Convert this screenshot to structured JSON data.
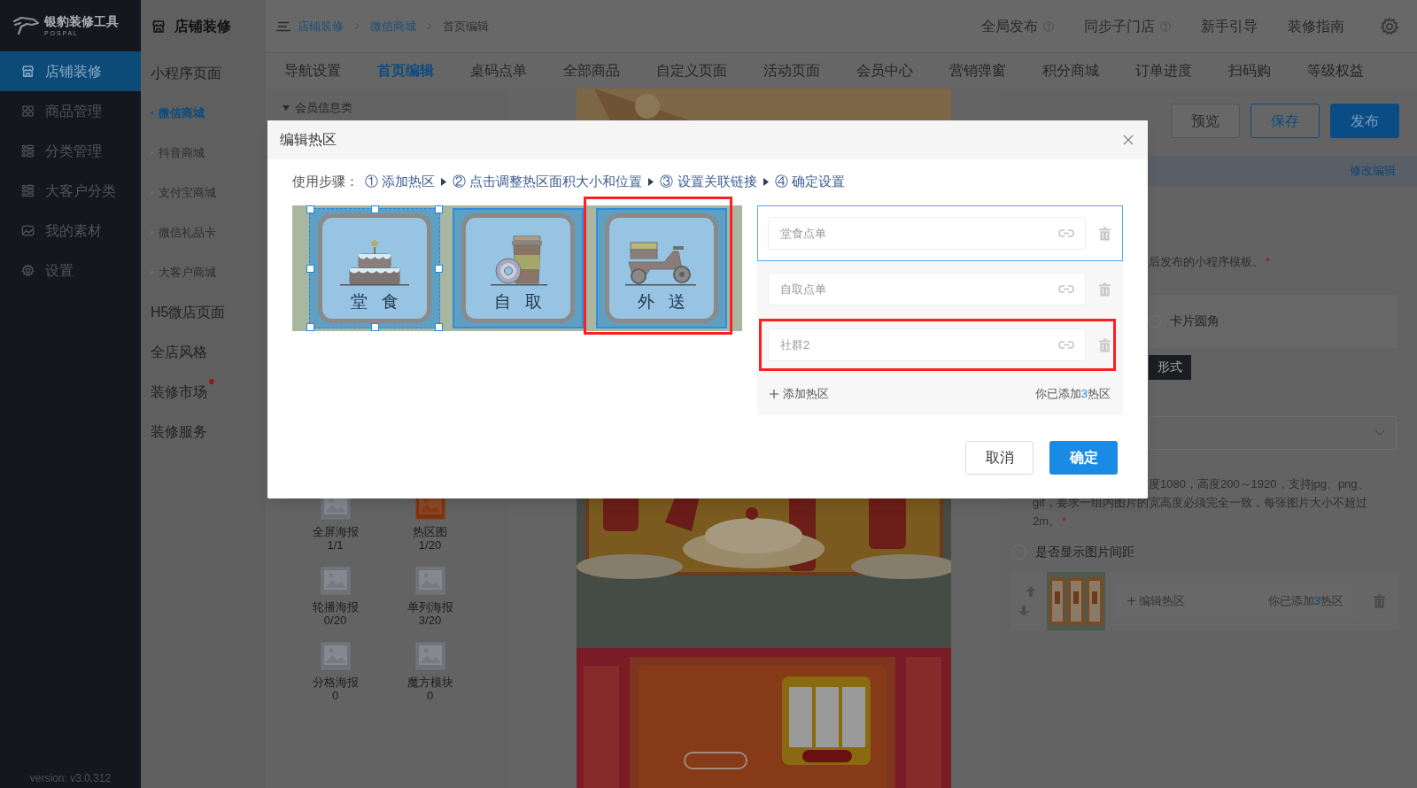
{
  "sidebar": {
    "logo": {
      "name": "银豹装修工具",
      "subtext": "P O S P A L"
    },
    "items": [
      {
        "label": "店铺装修",
        "selected": true
      },
      {
        "label": "商品管理",
        "selected": false
      },
      {
        "label": "分类管理",
        "selected": false
      },
      {
        "label": "大客户分类",
        "selected": false
      },
      {
        "label": "我的素材",
        "selected": false
      },
      {
        "label": "设置",
        "selected": false
      }
    ],
    "version": "version: v3.0.312"
  },
  "subnav": {
    "title": "店铺装修",
    "items": [
      {
        "label": "小程序页面",
        "dot": false,
        "children": [
          {
            "label": "微信商城",
            "selected": true
          },
          {
            "label": "抖音商城",
            "selected": false
          },
          {
            "label": "支付宝商城",
            "selected": false
          },
          {
            "label": "微信礼品卡",
            "selected": false
          },
          {
            "label": "大客户商城",
            "selected": false
          }
        ]
      },
      {
        "label": "H5微店页面",
        "dot": false
      },
      {
        "label": "全店风格",
        "dot": false
      },
      {
        "label": "装修市场",
        "dot": true
      },
      {
        "label": "装修服务",
        "dot": false
      }
    ]
  },
  "header": {
    "breadcrumb": [
      {
        "label": "店铺装修",
        "link": true
      },
      {
        "label": "微信商城",
        "link": true
      },
      {
        "label": "首页编辑",
        "link": false
      }
    ],
    "actions": [
      {
        "label": "全局发布",
        "help": true
      },
      {
        "label": "同步子门店",
        "help": true
      },
      {
        "label": "新手引导",
        "help": false
      },
      {
        "label": "装修指南",
        "help": false
      }
    ]
  },
  "tabs": [
    {
      "label": "导航设置",
      "selected": false
    },
    {
      "label": "首页编辑",
      "selected": true
    },
    {
      "label": "桌码点单",
      "selected": false
    },
    {
      "label": "全部商品",
      "selected": false
    },
    {
      "label": "自定义页面",
      "selected": false
    },
    {
      "label": "活动页面",
      "selected": false
    },
    {
      "label": "会员中心",
      "selected": false
    },
    {
      "label": "营销弹窗",
      "selected": false
    },
    {
      "label": "积分商城",
      "selected": false
    },
    {
      "label": "订单进度",
      "selected": false
    },
    {
      "label": "扫码购",
      "selected": false
    },
    {
      "label": "等级权益",
      "selected": false
    }
  ],
  "components": {
    "group": "会员信息类",
    "items": [
      {
        "name": "全屏海报",
        "count": "1/1",
        "active": false
      },
      {
        "name": "热区图",
        "count": "1/20",
        "active": true
      },
      {
        "name": "轮播海报",
        "count": "0/20",
        "active": false
      },
      {
        "name": "单列海报",
        "count": "3/20",
        "active": false
      },
      {
        "name": "分格海报",
        "count": "0",
        "active": false
      },
      {
        "name": "魔方模块",
        "count": "0",
        "active": false
      }
    ]
  },
  "toolbar": {
    "buttons": [
      {
        "label": "预览",
        "kind": "default"
      },
      {
        "label": "保存",
        "kind": "outline"
      },
      {
        "label": "发布",
        "kind": "primary"
      }
    ]
  },
  "settings": {
    "edit_link": "修改编辑",
    "template_note": {
      "text": "后发布的小程序模板。",
      "required_mark": "*"
    },
    "card_corner": {
      "label": "卡片圆角",
      "checked": false
    },
    "style_tag": "形式",
    "image_note": {
      "lines": [
        "度1080，高度200～1920，支持jpg、png、",
        "gif，要求一组内图片的宽高度必须完全一致，每张图片大小不超过",
        "2m。"
      ],
      "required_mark": "*"
    },
    "show_spacing": {
      "label": "是否显示图片间距",
      "checked": false
    },
    "hotzone_item": {
      "edit_label": "编辑热区",
      "count_prefix": "你已添加",
      "count": "3",
      "count_suffix": "热区"
    }
  },
  "modal": {
    "title": "编辑热区",
    "steps_label": "使用步骤：",
    "steps": [
      "① 添加热区",
      "② 点击调整热区面积大小和位置",
      "③ 设置关联链接",
      "④ 确定设置"
    ],
    "hotspots": [
      {
        "label": "堂 食",
        "link": "堂食点单",
        "selected": true,
        "annotated": false
      },
      {
        "label": "自 取",
        "link": "自取点单",
        "selected": false,
        "annotated": false
      },
      {
        "label": "外 送",
        "link": "社群2",
        "selected": false,
        "annotated": true
      }
    ],
    "add_label": "添加热区",
    "count_prefix": "你已添加",
    "count": "3",
    "count_suffix": "热区",
    "buttons": [
      {
        "label": "取消",
        "kind": "default"
      },
      {
        "label": "确定",
        "kind": "primary"
      }
    ]
  }
}
